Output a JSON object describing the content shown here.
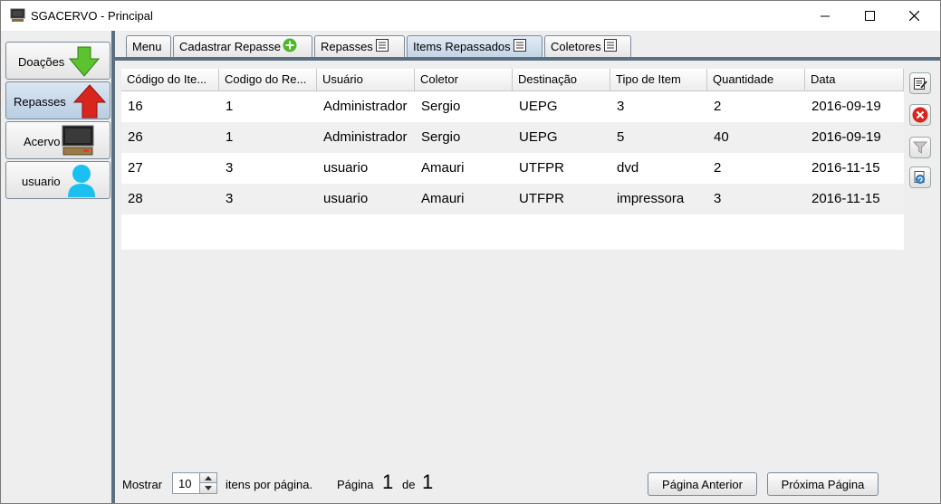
{
  "window": {
    "title": "SGACERVO - Principal"
  },
  "sidebar": {
    "items": [
      {
        "label": "Doações",
        "icon": "green-down-arrow-icon"
      },
      {
        "label": "Repasses",
        "icon": "red-up-arrow-icon"
      },
      {
        "label": "Acervo",
        "icon": "computer-icon"
      },
      {
        "label": "usuario",
        "icon": "user-icon"
      }
    ],
    "active": "Repasses"
  },
  "tabs": [
    {
      "label": "Menu"
    },
    {
      "label": "Cadastrar Repasse",
      "icon": "add-icon"
    },
    {
      "label": "Repasses",
      "icon": "list-icon"
    },
    {
      "label": "Items Repassados",
      "icon": "list-icon"
    },
    {
      "label": "Coletores",
      "icon": "list-icon"
    }
  ],
  "active_tab": "Items Repassados",
  "table": {
    "columns": [
      "Código do Ite...",
      "Codigo do Re...",
      "Usuário",
      "Coletor",
      "Destinação",
      "Tipo de Item",
      "Quantidade",
      "Data"
    ],
    "rows": [
      [
        "16",
        "1",
        "Administrador",
        "Sergio",
        "UEPG",
        "3",
        "2",
        "2016-09-19"
      ],
      [
        "26",
        "1",
        "Administrador",
        "Sergio",
        "UEPG",
        "5",
        "40",
        "2016-09-19"
      ],
      [
        "27",
        "3",
        "usuario",
        "Amauri",
        "UTFPR",
        "dvd",
        "2",
        "2016-11-15"
      ],
      [
        "28",
        "3",
        "usuario",
        "Amauri",
        "UTFPR",
        "impressora",
        "3",
        "2016-11-15"
      ]
    ]
  },
  "toolbar_icons": [
    "edit-icon",
    "delete-icon",
    "filter-icon",
    "refresh-icon"
  ],
  "footer": {
    "show_label": "Mostrar",
    "per_page_value": "10",
    "per_page_suffix": "itens por página.",
    "page_label": "Página",
    "current_page": "1",
    "of_label": "de",
    "total_pages": "1",
    "prev_button": "Página Anterior",
    "next_button": "Próxima Página"
  },
  "colors": {
    "accent": "#5b6f82",
    "active_tab": "#c4d5e6",
    "row_alt": "#f0f0f0",
    "delete_red": "#d9261c"
  }
}
